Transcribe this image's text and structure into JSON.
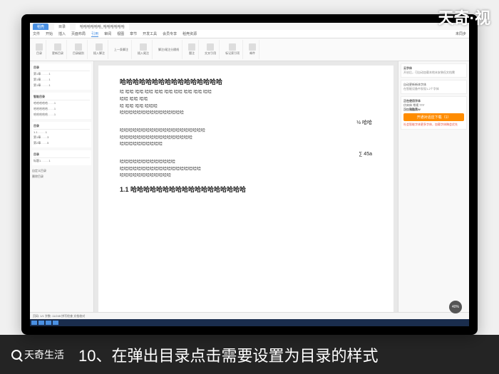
{
  "watermark": "天奇·视",
  "titlebar": {
    "tab1": "稻壳",
    "tab2": "目录",
    "tab3": "哈哈哈哈哈哈_哈哈哈哈哈哈"
  },
  "menubar": {
    "items": [
      "文件",
      "开始",
      "插入",
      "页面布局",
      "引用",
      "审阅",
      "视图",
      "章节",
      "开发工具",
      "会员专享",
      "稻壳资源"
    ],
    "right": "未同步"
  },
  "ribbon": {
    "groups": [
      "目录",
      "更新目录",
      "目录级别",
      "插入脚注",
      "上一条脚注",
      "插入尾注",
      "脚注/尾注分隔线",
      "题注",
      "交叉引用",
      "标记索引项",
      "邮件",
      "插入表目录"
    ]
  },
  "left": {
    "title1": "目录",
    "title2": "智能目录",
    "items": [
      "第1章",
      "第1章",
      "第1章",
      "1.1",
      "第1章",
      "第2章",
      "第3章"
    ],
    "title3": "目录",
    "custom": "自定义目录",
    "remove": "删除目录"
  },
  "document": {
    "heading": "哈哈哈哈哈哈哈哈哈哈哈哈哈哈哈哈",
    "lines": [
      "哈 哈哈 哈哈 哈哈 哈哈 哈哈 哈哈 哈哈 哈哈 哈哈",
      "哈哈 哈哈 哈哈",
      "哈 哈哈 哈哈 哈哈哈",
      "哈哈哈哈哈哈哈哈哈哈哈哈哈哈哈",
      "哈哈哈哈哈哈哈哈哈哈哈哈哈哈哈哈哈哈哈哈",
      "哈哈哈哈哈哈哈哈哈哈哈哈哈哈哈哈哈",
      "哈哈哈哈哈哈哈哈哈哈",
      "哈哈哈哈哈哈哈哈哈哈哈哈哈",
      "哈哈哈哈哈哈哈哈哈哈哈哈哈哈哈哈哈哈哈",
      "哈哈哈哈哈哈哈哈哈哈哈哈"
    ],
    "formula1": "½ 哈哈",
    "formula2": "∑ 45a",
    "subheading": "1.1 哈哈哈哈哈哈哈哈哈哈哈哈哈哈哈哈哈哈"
  },
  "right": {
    "title": "云字体",
    "desc": "开启后，可自动加载本地未安装但文档需",
    "opt1": "自动更新新体字体",
    "note": "在智能设备中发现1-2个字体",
    "section": "正在使用字体",
    "font1": "仿宋体 常规 TTF",
    "font2": "汉仪雅酷黑W",
    "button": "开通对话应下载（1）",
    "warning": "社会智能字体更多字体，加载字体稿会优先"
  },
  "status": {
    "left": "页码: 1/1  字数: 11/245  拼写检查  文档校对",
    "zoom": "40%"
  },
  "caption": {
    "brand": "天奇生活",
    "text": "10、在弹出目录点击需要设置为目录的样式"
  }
}
